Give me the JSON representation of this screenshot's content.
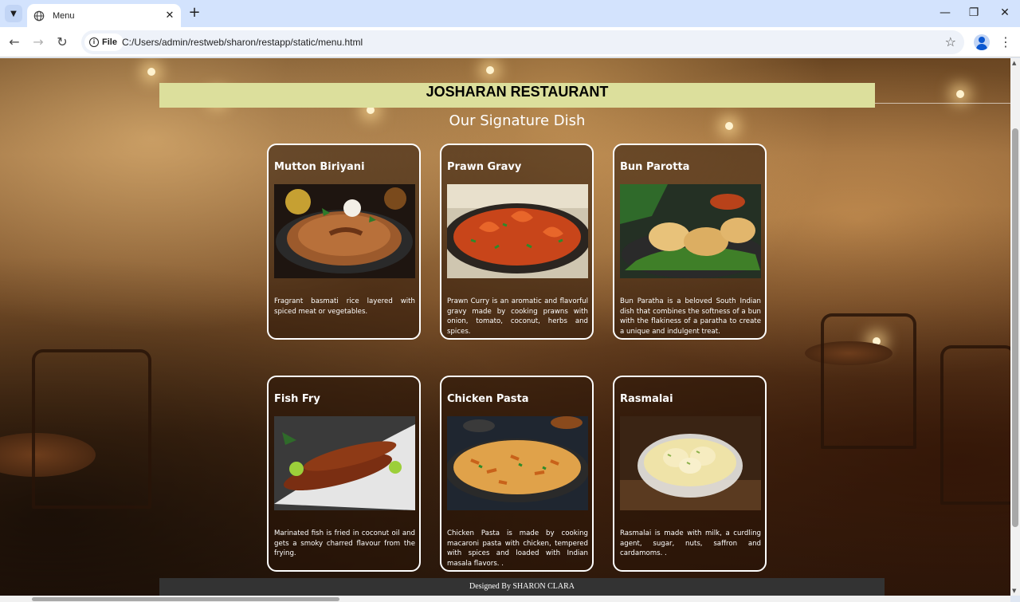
{
  "browser": {
    "tab_title": "Menu",
    "address_chip": "File",
    "url": "C:/Users/admin/restweb/sharon/restapp/static/menu.html"
  },
  "page": {
    "restaurant_name": "JOSHARAN RESTAURANT",
    "section_title": "Our Signature Dish",
    "footer": "Designed By SHARON CLARA"
  },
  "dishes": [
    {
      "name": "Mutton Biriyani",
      "description": "Fragrant basmati rice layered with spiced meat or vegetables."
    },
    {
      "name": "Prawn Gravy",
      "description": "Prawn Curry is an aromatic and flavorful gravy made by cooking prawns with onion, tomato, coconut, herbs and spices."
    },
    {
      "name": "Bun Parotta",
      "description": "Bun Paratha is a beloved South Indian dish that combines the softness of a bun with the flakiness of a paratha to create a unique and indulgent treat."
    },
    {
      "name": "Fish Fry",
      "description": "Marinated fish is fried in coconut oil and gets a smoky charred flavour from the frying."
    },
    {
      "name": "Chicken Pasta",
      "description": "Chicken Pasta is made by cooking macaroni pasta with chicken, tempered with spices and loaded with Indian masala flavors. ."
    },
    {
      "name": "Rasmalai",
      "description": "Rasmalai is made with milk, a curdling agent, sugar, nuts, saffron and cardamoms. ."
    }
  ]
}
